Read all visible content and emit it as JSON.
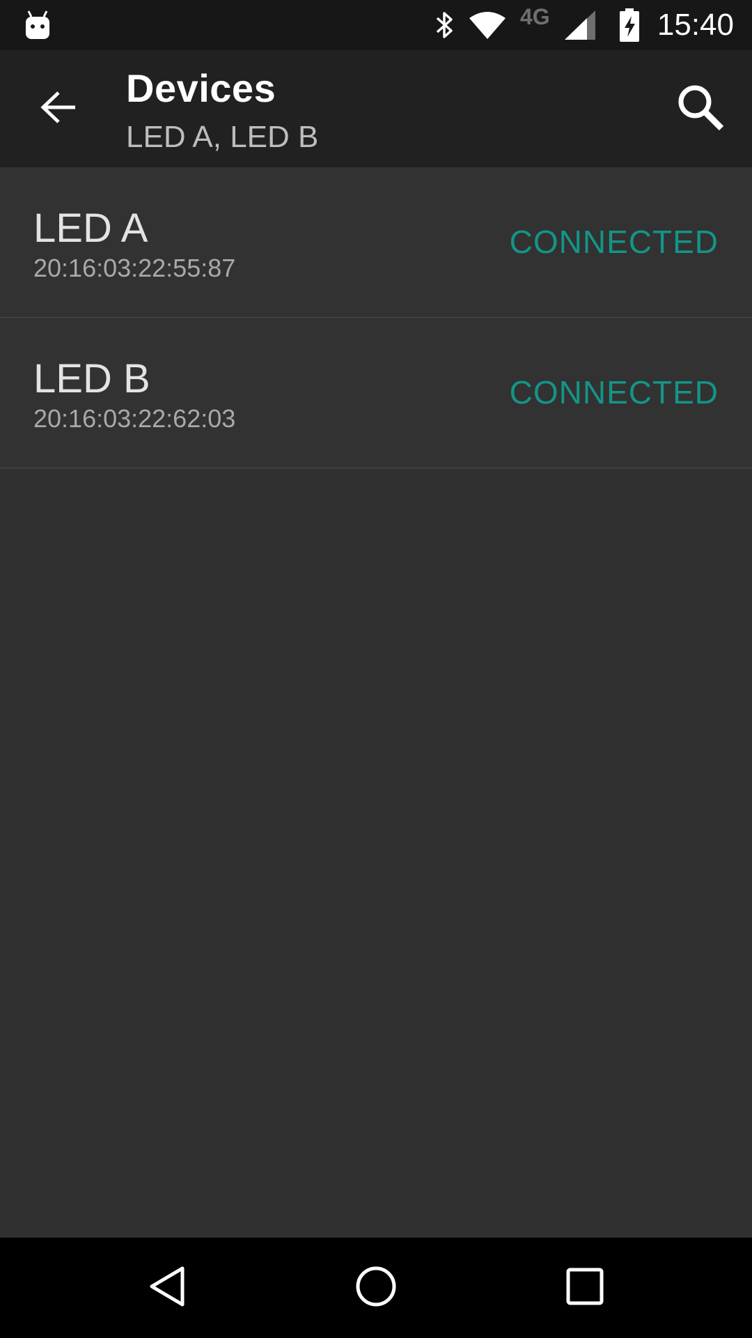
{
  "status_bar": {
    "time": "15:40",
    "network_type": "4G",
    "icons": [
      "android-debug-icon",
      "bluetooth-icon",
      "wifi-icon",
      "cell-signal-icon",
      "battery-charging-icon"
    ]
  },
  "app_bar": {
    "title": "Devices",
    "subtitle": "LED A, LED B",
    "back_icon": "arrow-back-icon",
    "search_icon": "search-icon"
  },
  "devices": [
    {
      "name": "LED A",
      "address": "20:16:03:22:55:87",
      "status": "CONNECTED"
    },
    {
      "name": "LED B",
      "address": "20:16:03:22:62:03",
      "status": "CONNECTED"
    }
  ],
  "nav_bar": {
    "icons": [
      "back-triangle-icon",
      "home-circle-icon",
      "recents-square-icon"
    ]
  },
  "colors": {
    "status_bar_bg": "#171717",
    "app_bar_bg": "#212121",
    "list_bg": "#323232",
    "accent": "#139588",
    "nav_bar_bg": "#000000"
  }
}
